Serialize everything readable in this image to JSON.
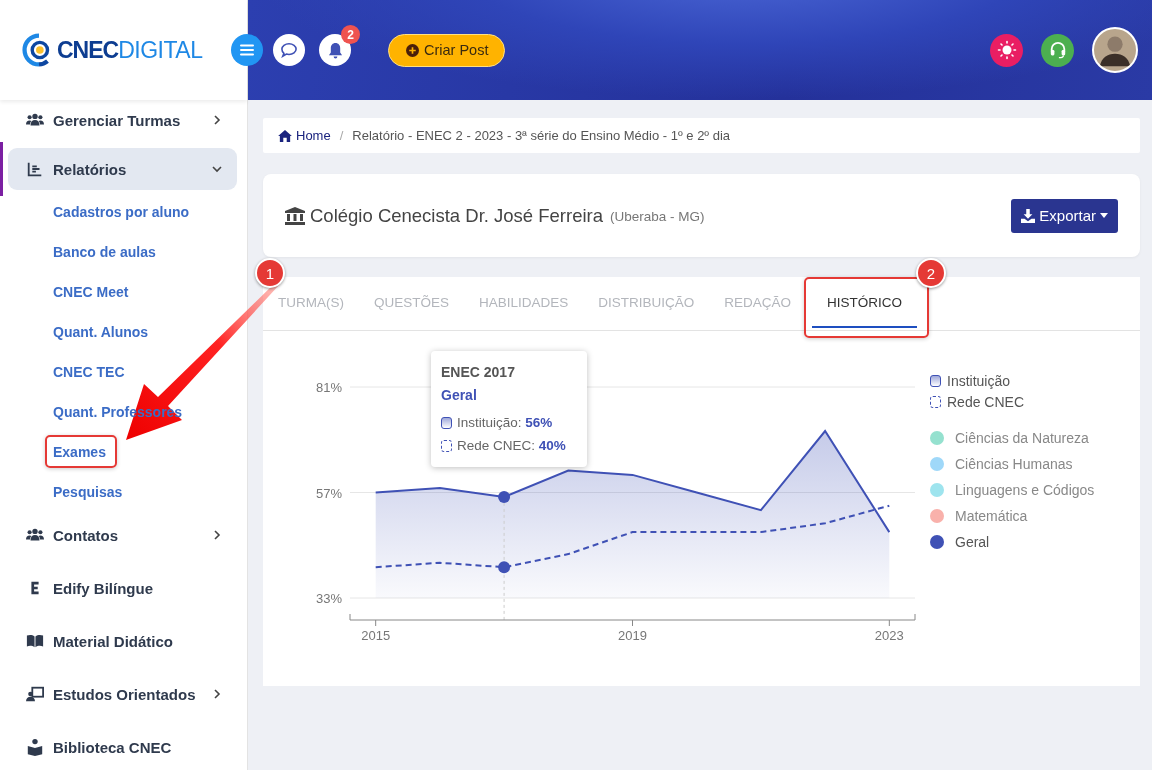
{
  "header": {
    "logo": {
      "bold": "CNEC",
      "light": "DIGITAL"
    },
    "notifications": "2",
    "create_button": "Criar Post"
  },
  "sidebar": {
    "items": [
      {
        "label": "Gerenciar Turmas",
        "kind": "group",
        "expanded": false,
        "selected": false
      },
      {
        "label": "Relatórios",
        "kind": "group",
        "expanded": true,
        "selected": true,
        "children": [
          {
            "label": "Cadastros por aluno",
            "highlighted": false
          },
          {
            "label": "Banco de aulas",
            "highlighted": false
          },
          {
            "label": "CNEC Meet",
            "highlighted": false
          },
          {
            "label": "Quant. Alunos",
            "highlighted": false
          },
          {
            "label": "CNEC TEC",
            "highlighted": false
          },
          {
            "label": "Quant. Professores",
            "highlighted": false
          },
          {
            "label": "Exames",
            "highlighted": true
          },
          {
            "label": "Pesquisas",
            "highlighted": false
          }
        ]
      },
      {
        "label": "Contatos",
        "kind": "group",
        "expanded": false,
        "selected": false
      },
      {
        "label": "Edify Bilíngue",
        "kind": "link",
        "selected": false
      },
      {
        "label": "Material Didático",
        "kind": "link",
        "selected": false
      },
      {
        "label": "Estudos Orientados",
        "kind": "group",
        "expanded": false,
        "selected": false
      },
      {
        "label": "Biblioteca CNEC",
        "kind": "link",
        "selected": false
      }
    ]
  },
  "breadcrumb": {
    "home": "Home",
    "separator": "/",
    "current": "Relatório - ENEC 2 - 2023 - 3ª série do Ensino Médio - 1º e 2º dia"
  },
  "school": {
    "name": "Colégio Cenecista Dr. José Ferreira",
    "location": "(Uberaba - MG)",
    "export_button": "Exportar"
  },
  "tabs": [
    {
      "label": "TURMA(S)",
      "selected": false,
      "highlighted": false
    },
    {
      "label": "QUESTÕES",
      "selected": false,
      "highlighted": false
    },
    {
      "label": "HABILIDADES",
      "selected": false,
      "highlighted": false
    },
    {
      "label": "DISTRIBUIÇÃO",
      "selected": false,
      "highlighted": false
    },
    {
      "label": "REDAÇÃO",
      "selected": false,
      "highlighted": false
    },
    {
      "label": "HISTÓRICO",
      "selected": true,
      "highlighted": true
    }
  ],
  "chart": {
    "chart_data": {
      "type": "area",
      "x": [
        2015,
        2016,
        2017,
        2018,
        2019,
        2020,
        2021,
        2022,
        2023
      ],
      "series": [
        {
          "name": "Instituição",
          "color": "#3f51b5",
          "values": [
            57,
            58,
            56,
            62,
            61,
            57,
            53,
            71,
            48
          ]
        },
        {
          "name": "Rede CNEC",
          "color": "#3f51b5",
          "type": "line",
          "line_style": "dashed",
          "values": [
            40,
            41,
            40,
            43,
            48,
            48,
            48,
            50,
            54
          ]
        }
      ],
      "xlim": [
        2014.6,
        2023.4
      ],
      "ylim": [
        28,
        81
      ],
      "xticks": [
        2015,
        2019,
        2023
      ],
      "yticks": [
        {
          "value": 33,
          "label": "33%"
        },
        {
          "value": 57,
          "label": "57%"
        },
        {
          "value": 81,
          "label": "81%"
        }
      ],
      "grid": true
    },
    "tooltip": {
      "title": "ENEC 2017",
      "subtitle": "Geral",
      "rows": [
        {
          "kind": "area",
          "text": "Instituição: **56%**"
        },
        {
          "kind": "dashed",
          "text": "Rede CNEC: **40%**"
        }
      ]
    },
    "subject_legend": [
      {
        "label": "Ciências da Natureza",
        "color": "#95e1cf",
        "selected": false
      },
      {
        "label": "Ciências Humanas",
        "color": "#9fd8f9",
        "selected": false
      },
      {
        "label": "Linguagens e Códigos",
        "color": "#9ee4ee",
        "selected": false
      },
      {
        "label": "Matemática",
        "color": "#f9b1ab",
        "selected": false
      },
      {
        "label": "Geral",
        "color": "#3f51b5",
        "selected": true
      }
    ]
  },
  "annotations": [
    {
      "label": "1"
    },
    {
      "label": "2"
    }
  ]
}
